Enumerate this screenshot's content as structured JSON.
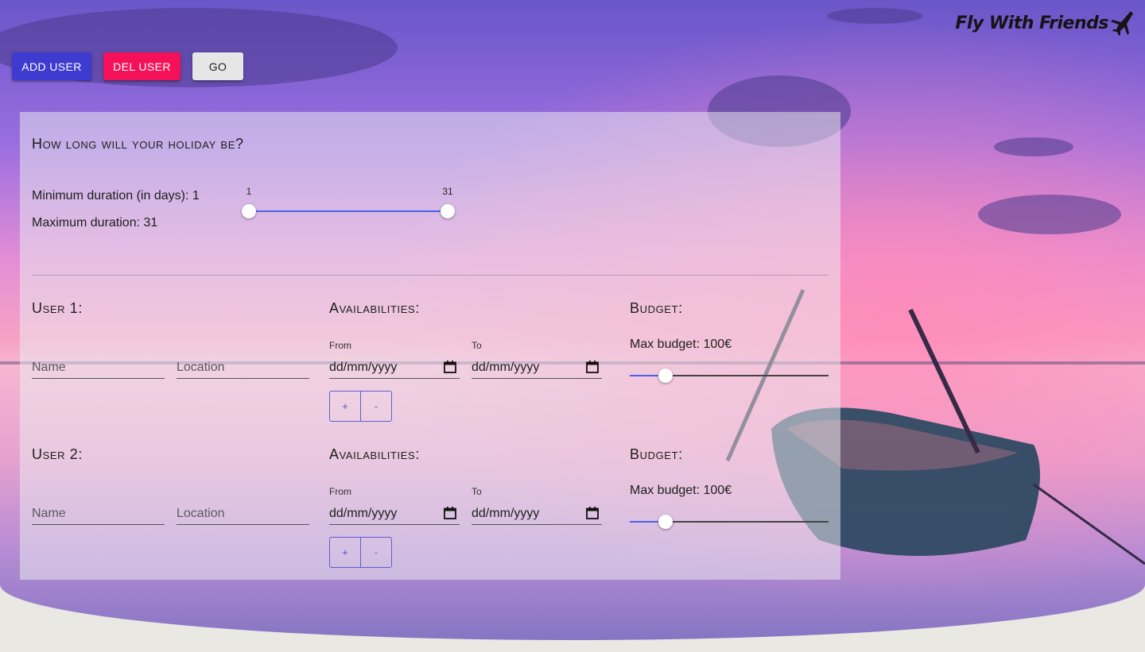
{
  "brand": {
    "logo_text": "Fly With Friends",
    "logo_icon": "airplane-icon"
  },
  "toolbar": {
    "add_user_label": "ADD USER",
    "del_user_label": "DEL USER",
    "go_label": "GO"
  },
  "holiday": {
    "heading": "How long will your holiday be?",
    "min_text": "Minimum duration (in days): 1",
    "max_text": "Maximum duration: 31",
    "slider": {
      "min_label": "1",
      "max_label": "31",
      "min": 1,
      "max": 31,
      "low": 1,
      "high": 31
    }
  },
  "users": [
    {
      "heading": "User 1:",
      "name_placeholder": "Name",
      "location_placeholder": "Location",
      "availability_heading": "Availabilities:",
      "from_label": "From",
      "to_label": "To",
      "from_value": "dd/mm/yyyy",
      "to_value": "dd/mm/yyyy",
      "plus_label": "+",
      "minus_label": "-",
      "budget_heading": "Budget:",
      "budget_text": "Max budget: 100€",
      "budget_fraction": 0.18
    },
    {
      "heading": "User 2:",
      "name_placeholder": "Name",
      "location_placeholder": "Location",
      "availability_heading": "Availabilities:",
      "from_label": "From",
      "to_label": "To",
      "from_value": "dd/mm/yyyy",
      "to_value": "dd/mm/yyyy",
      "plus_label": "+",
      "minus_label": "-",
      "budget_heading": "Budget:",
      "budget_text": "Max budget: 100€",
      "budget_fraction": 0.18
    }
  ],
  "colors": {
    "primary": "#3d3bd0",
    "danger": "#f5115a",
    "slider": "#4a63e8"
  }
}
